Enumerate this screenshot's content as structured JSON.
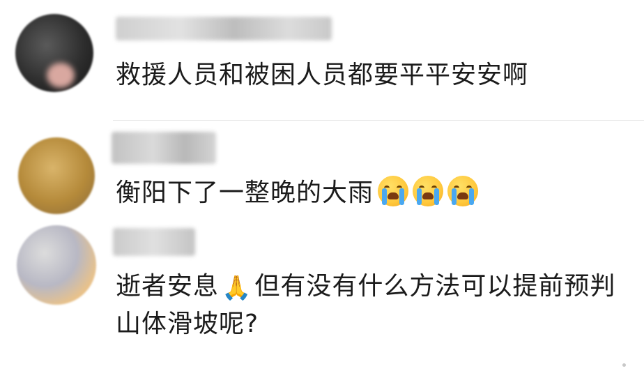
{
  "comments": [
    {
      "text": "救援人员和被困人员都要平平安安啊"
    },
    {
      "text": "衡阳下了一整晚的大雨",
      "emojis": [
        "loudly-crying-face",
        "loudly-crying-face",
        "loudly-crying-face"
      ]
    },
    {
      "text_line1_a": "逝者安息",
      "emoji": "folded-hands",
      "text_line1_b": "但有没有什么方法可以提前预判",
      "text_line2": "山体滑坡呢?"
    }
  ],
  "colors": {
    "text": "#1b1b1b",
    "divider": "#e6e6e6",
    "emoji_yellow": "#ffc83d",
    "tear_blue": "#4aa8f0"
  }
}
